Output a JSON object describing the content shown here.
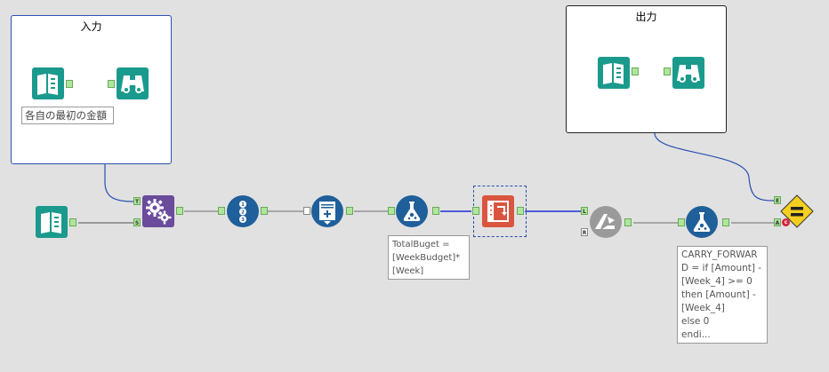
{
  "containers": {
    "input": {
      "title": "入力"
    },
    "output": {
      "title": "出力"
    }
  },
  "annotations": {
    "input_label": "各自の最初の金額",
    "formula1": "TotalBuget =\n[WeekBudget]*\n[Week]",
    "formula2": "CARRY_FORWAR\nD = if [Amount] -\n[Week_4] >= 0\nthen [Amount] -\n[Week_4]\nelse 0\nendi..."
  },
  "anchors": {
    "join_top": "T",
    "join_bottom": "S",
    "append_l": "L",
    "append_r": "R",
    "detour_e": "E",
    "detour_a": "A",
    "detour_c": "c"
  },
  "colors": {
    "teal": "#1a9a8c",
    "navy": "#1f5f9a",
    "purple": "#6a4b9c",
    "red": "#d9553f",
    "yellow": "#f4cf1f",
    "wire_blue": "#2a4fb0",
    "wire_grey": "#6d6d6d"
  }
}
